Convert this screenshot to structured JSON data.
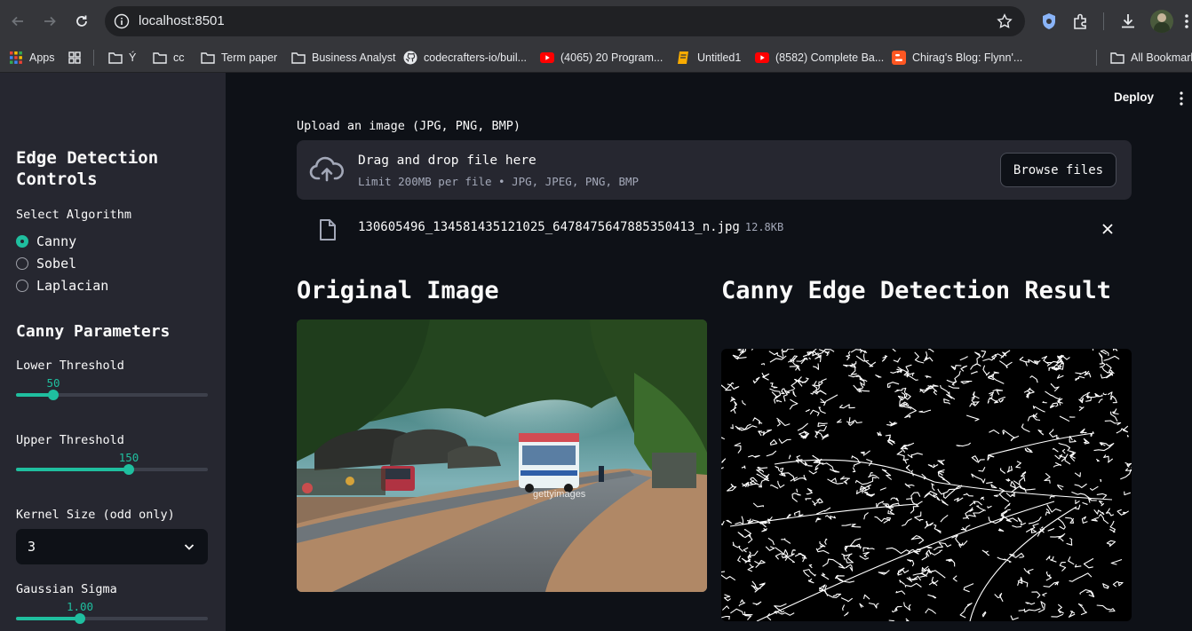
{
  "browser": {
    "url": "localhost:8501",
    "bookmarks": [
      {
        "label": "Apps",
        "icon": "apps-grid-icon"
      },
      {
        "label": "",
        "icon": "grid-icon"
      },
      {
        "label": "Ý",
        "icon": "folder-icon"
      },
      {
        "label": "cc",
        "icon": "folder-icon"
      },
      {
        "label": "Term paper",
        "icon": "folder-icon"
      },
      {
        "label": "Business Analyst",
        "icon": "folder-icon"
      },
      {
        "label": "codecrafters-io/buil...",
        "icon": "github-icon"
      },
      {
        "label": "(4065) 20 Program...",
        "icon": "youtube-icon"
      },
      {
        "label": "Untitled1",
        "icon": "notebook-icon"
      },
      {
        "label": "(8582) Complete Ba...",
        "icon": "youtube-icon"
      },
      {
        "label": "Chirag's Blog: Flynn'...",
        "icon": "blogger-icon"
      },
      {
        "label": "All Bookmarks",
        "icon": "folder-icon"
      }
    ]
  },
  "sidebar": {
    "title": "Edge Detection Controls",
    "algorithm": {
      "label": "Select Algorithm",
      "options": [
        "Canny",
        "Sobel",
        "Laplacian"
      ],
      "selected": "Canny"
    },
    "params_title": "Canny Parameters",
    "lower": {
      "label": "Lower Threshold",
      "value": "50",
      "fraction": 0.196
    },
    "upper": {
      "label": "Upper Threshold",
      "value": "150",
      "fraction": 0.588
    },
    "kernel": {
      "label": "Kernel Size (odd only)",
      "value": "3"
    },
    "sigma": {
      "label": "Gaussian Sigma",
      "value": "1.00",
      "fraction": 0.333
    }
  },
  "header": {
    "deploy_label": "Deploy"
  },
  "uploader": {
    "label": "Upload an image (JPG, PNG, BMP)",
    "drag_text": "Drag and drop file here",
    "limit_text": "Limit 200MB per file • JPG, JPEG, PNG, BMP",
    "browse_label": "Browse files",
    "file_name": "130605496_134581435121025_6478475647885350413_n.jpg",
    "file_size": "12.8KB"
  },
  "results": {
    "original_title": "Original Image",
    "result_title": "Canny Edge Detection Result",
    "watermark": "gettyimages"
  },
  "colors": {
    "accent": "#1fbf9f",
    "sidebar_bg": "#262730",
    "main_bg": "#0e1117"
  }
}
